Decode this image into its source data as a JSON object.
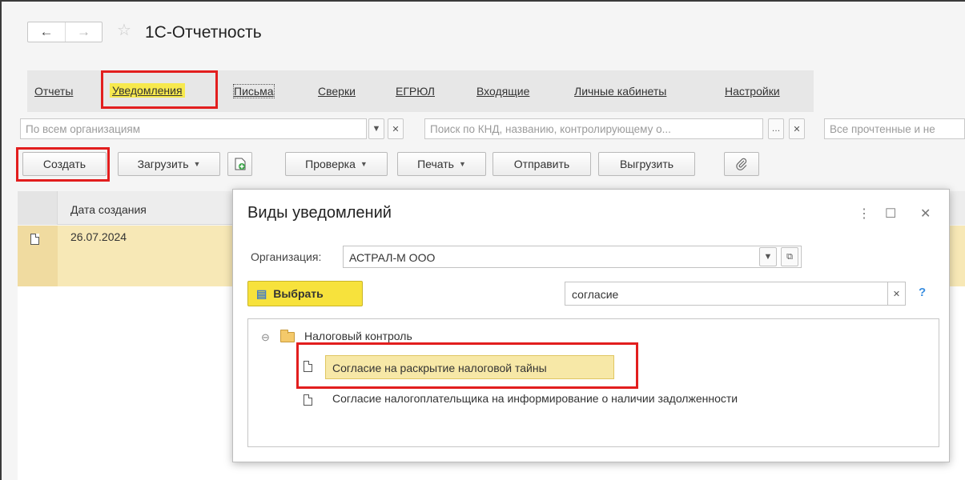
{
  "header": {
    "title": "1С-Отчетность",
    "back_icon": "arrow-left-icon",
    "forward_icon": "arrow-right-icon",
    "favorite_icon": "star-icon"
  },
  "tabs": [
    {
      "label": "Отчеты"
    },
    {
      "label": "Уведомления",
      "active": true
    },
    {
      "label": "Письма"
    },
    {
      "label": "Сверки"
    },
    {
      "label": "ЕГРЮЛ"
    },
    {
      "label": "Входящие"
    },
    {
      "label": "Личные кабинеты"
    },
    {
      "label": "Настройки"
    }
  ],
  "filters": {
    "organization_placeholder": "По всем организациям",
    "search_placeholder": "Поиск по КНД, названию, контролирующему о...",
    "status_placeholder": "Все прочтенные и не"
  },
  "toolbar": {
    "create": "Создать",
    "load": "Загрузить",
    "check": "Проверка",
    "print": "Печать",
    "send": "Отправить",
    "export": "Выгрузить"
  },
  "list": {
    "column_date": "Дата создания",
    "rows": [
      {
        "date": "26.07.2024"
      }
    ]
  },
  "dialog": {
    "title": "Виды уведомлений",
    "org_label": "Организация:",
    "org_value": "АСТРАЛ-М ООО",
    "select_button": "Выбрать",
    "search_value": "согласие",
    "help": "?",
    "group": "Налоговый контроль",
    "items": [
      "Согласие на раскрытие налоговой тайны",
      "Согласие налогоплательщика на информирование о наличии задолженности"
    ]
  },
  "colors": {
    "active_tab": "#f7e94e",
    "select_button": "#f7e23c",
    "highlight": "#e21e1e",
    "selected_row": "#f7e8b6",
    "help": "#3a8ee0"
  }
}
